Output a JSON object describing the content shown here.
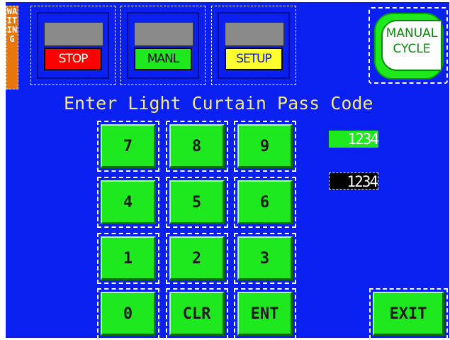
{
  "status": {
    "waiting_text": "WAITING"
  },
  "mode_buttons": [
    {
      "label": "STOP",
      "color": "#ff0000",
      "text_color": "#ffffff"
    },
    {
      "label": "MANL",
      "color": "#1ee81e",
      "text_color": "#0a0a0a"
    },
    {
      "label": "SETUP",
      "color": "#ffff30",
      "text_color": "#1020c0"
    }
  ],
  "manual_cycle": {
    "line1": "MANUAL",
    "line2": "CYCLE"
  },
  "prompt": "Enter Light Curtain Pass Code",
  "keypad": {
    "keys": [
      "7",
      "8",
      "9",
      "4",
      "5",
      "6",
      "1",
      "2",
      "3",
      "0",
      "CLR",
      "ENT"
    ]
  },
  "fields": {
    "entered_code": "1234",
    "confirm_code": "1234"
  },
  "exit_label": "EXIT",
  "colors": {
    "background": "#0a20f0",
    "key_green": "#1ee81e",
    "prompt_text": "#f4e880",
    "waiting_bg": "#e8760a"
  }
}
